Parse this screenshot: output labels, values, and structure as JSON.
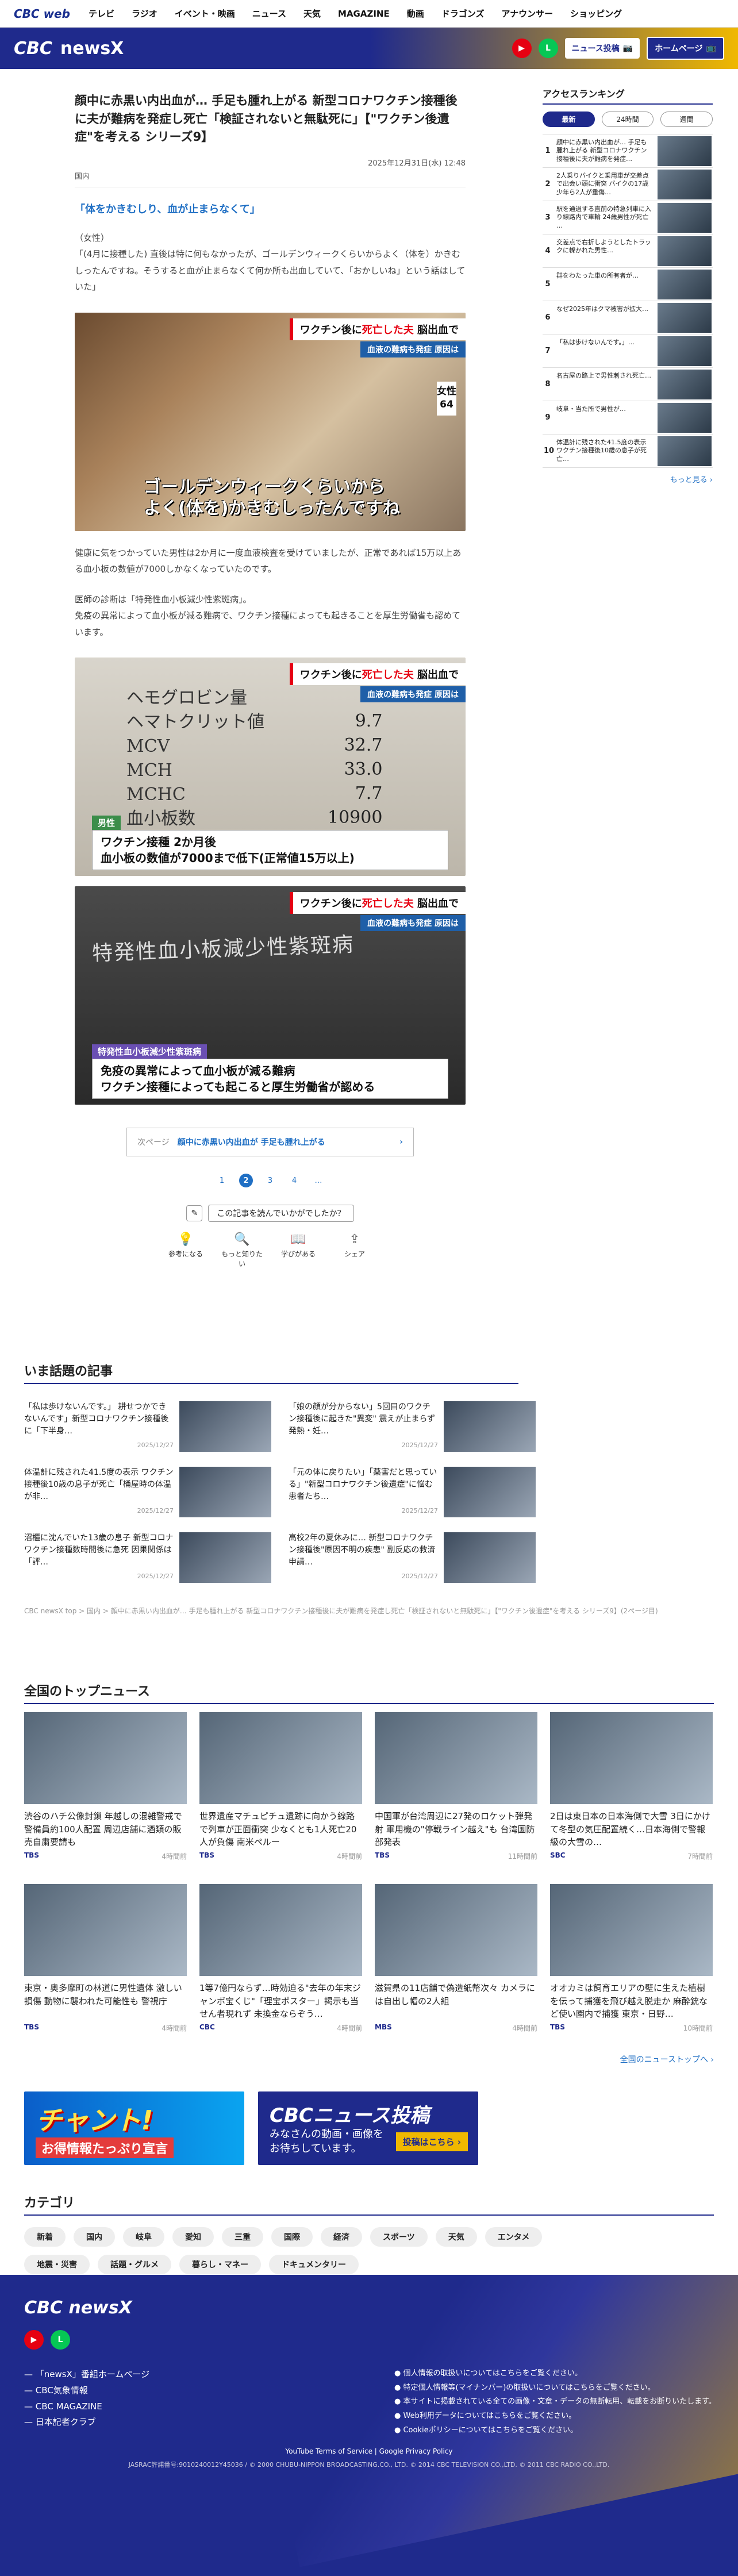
{
  "top_nav": {
    "logo": "CBC web",
    "items": [
      "テレビ",
      "ラジオ",
      "イベント・映画",
      "ニュース",
      "天気",
      "MAGAZINE",
      "動画",
      "ドラゴンズ",
      "アナウンサー",
      "ショッピング"
    ]
  },
  "header": {
    "logo_cbc": "CBC",
    "logo_news": "newsX",
    "btn_post": "ニュース投稿",
    "btn_home": "ホームページ"
  },
  "article": {
    "title": "顔中に赤黒い内出血が… 手足も腫れ上がる 新型コロナワクチン接種後に夫が難病を発症し死亡「検証されないと無駄死に」【\"ワクチン後遺症\"を考える シリーズ9】",
    "date": "2025年12月31日(水) 12:48",
    "category": "国内",
    "subhead": "「体をかきむしり、血が止まらなくて」",
    "para1": "（女性）\n「(4月に接種した) 直後は特に何もなかったが、ゴールデンウィークくらいからよく（体を）かきむしったんですね。そうすると血が止まらなくて何か所も出血していて、「おかしいね」という話はしていた」",
    "para2": "健康に気をつかっていた男性は2か月に一度血液検査を受けていましたが、正常であれば15万以上ある血小板の数値が7000しかなくなっていたのです。",
    "para3": "医師の診断は「特発性血小板減少性紫斑病」。\n免疫の異常によって血小板が減る難病で、ワクチン接種によっても起きることを厚生労働省も認めています。",
    "badge_pre": "ワクチン後に",
    "badge_red": "死亡した夫",
    "badge_post": "脳出血で",
    "badge_sub": "血液の難病も発症 原因は",
    "photo1_caption": "ゴールデンウィークくらいから\nよく(体を)かきむしったんですね",
    "photo1_label": "女性",
    "photo1_age": "64",
    "photo2_items": "ヘモグロビン量\nヘマトクリット値\nMCV\nMCH\nMCHC\n血小板数",
    "photo2_nums": "9.7\n32.7\n33.0\n7.7\n10900",
    "photo2_label": "男性",
    "photo2_caption": "ワクチン接種 2か月後\n血小板の数値が7000まで低下(正常値15万以上)",
    "photo3_doc": "特発性血小板減少性紫斑病",
    "photo3_label": "特発性血小板減少性紫斑病",
    "photo3_caption": "免疫の異常によって血小板が減る難病\nワクチン接種によっても起こると厚生労働省が認める",
    "next_label": "次ページ",
    "next_text": "顔中に赤黒い内出血が 手足も腫れ上がる",
    "pages": [
      "1",
      "2",
      "3",
      "4",
      "…"
    ],
    "feedback_prompt": "この記事を読んでいかがでしたか？",
    "reactions": [
      "参考になる",
      "もっと知りたい",
      "学びがある",
      "シェア"
    ]
  },
  "sidebar": {
    "title": "アクセスランキング",
    "tabs": [
      "最新",
      "24時間",
      "週間"
    ],
    "items": [
      "顔中に赤黒い内出血が… 手足も腫れ上がる 新型コロナワクチン接種後に夫が難病を発症…",
      "2人乗りバイクと乗用車が交差点で出会い頭に衝突 バイクの17歳少年ら2人が重傷…",
      "駅を通過する直前の特急列車に入り線路内で車輪 24歳男性が死亡 …",
      "交差点で右折しようとしたトラックに轢かれた男性…",
      "群をわたった車の所有者が…",
      "なぜ2025年はクマ被害が拡大…",
      "「私は歩けないんです。」…",
      "名古屋の路上で男性刺され死亡…",
      "岐阜・当た所で男性が…",
      "体温計に残された41.5度の表示 ワクチン接種後10歳の息子が死亡…"
    ],
    "more": "もっと見る ›"
  },
  "trending": {
    "title": "いま話題の記事",
    "items": [
      {
        "title": "「私は歩けないんです。」 耕せつかできないんです」新型コロナワクチン接種後に「下半身…",
        "date": "2025/12/27"
      },
      {
        "title": "「娘の顔が分からない」5回目のワクチン接種後に起きた\"異変\" 震えが止まらず発熱・妊…",
        "date": "2025/12/27"
      },
      {
        "title": "体温計に残された41.5度の表示 ワクチン接種後10歳の息子が死亡「桶屋時の体温が非…",
        "date": "2025/12/27"
      },
      {
        "title": "「元の体に戻りたい」「薬害だと思っている」\"新型コロナワクチン後遺症\"に悩む患者たち…",
        "date": "2025/12/27"
      },
      {
        "title": "沼櫃に沈んでいた13歳の息子 新型コロナワクチン接種数時間後に急死 因果関係は「評…",
        "date": "2025/12/27"
      },
      {
        "title": "高校2年の夏休みに… 新型コロナワクチン接種後\"原因不明の疾患\" 副反応の救済申請…",
        "date": "2025/12/27"
      }
    ]
  },
  "breadcrumb": "CBC newsX top > 国内 > 顔中に赤黒い内出血が… 手足も腫れ上がる 新型コロナワクチン接種後に夫が難病を発症し死亡「検証されないと無駄死に」【\"ワクチン後遺症\"を考える シリーズ9】(2ページ目)",
  "top_news": {
    "title": "全国のトップニュース",
    "items": [
      {
        "title": "渋谷のハチ公像封鎖 年越しの混雑警戒で警備員約100人配置 周辺店舗に酒類の販売自粛要請も",
        "src": "TBS",
        "ago": "4時間前"
      },
      {
        "title": "世界遺産マチュピチュ遺跡に向かう線路で列車が正面衝突 少なくとも1人死亡20人が負傷 南米ペルー",
        "src": "TBS",
        "ago": "4時間前"
      },
      {
        "title": "中国軍が台湾周辺に27発のロケット弾発射 軍用機の\"停戦ライン越え\"も 台湾国防部発表",
        "src": "TBS",
        "ago": "11時間前"
      },
      {
        "title": "2日は東日本の日本海側で大雪 3日にかけて冬型の気圧配置続く…日本海側で警報級の大雪の…",
        "src": "SBC",
        "ago": "7時間前"
      },
      {
        "title": "東京・奥多摩町の林道に男性遺体 激しい損傷 動物に襲われた可能性も 警視庁",
        "src": "TBS",
        "ago": "4時間前"
      },
      {
        "title": "1等7億円ならず…時効迫る\"去年の年末ジャンボ宝くじ\"「理宝ポスター」掲示も当せん者現れず 未換金ならぞう…",
        "src": "CBC",
        "ago": "4時間前"
      },
      {
        "title": "滋賀県の11店舗で偽造紙幣次々 カメラには自出し帽の2人組",
        "src": "MBS",
        "ago": "4時間前"
      },
      {
        "title": "オオカミは飼育エリアの壁に生えた植樹を伝って捕獲を飛び越え脱走か 麻酔銃など使い園内で捕獲 東京・日野…",
        "src": "TBS",
        "ago": "10時間前"
      }
    ],
    "more": "全国のニューストップへ ›"
  },
  "banners": {
    "b1_title": "チャント!",
    "b1_sub": "お得情報たっぷり宣言",
    "b2_title": "CBCニュース投稿",
    "b2_sub": "みなさんの動画・画像を\nお待ちしています。",
    "b2_btn": "投稿はこちら ›"
  },
  "categories": {
    "title": "カテゴリ",
    "items": [
      "新着",
      "国内",
      "岐阜",
      "愛知",
      "三重",
      "国際",
      "経済",
      "スポーツ",
      "天気",
      "エンタメ",
      "地震・災害",
      "話題・グルメ",
      "暮らし・マネー",
      "ドキュメンタリー"
    ]
  },
  "footer": {
    "logo": "CBC newsX",
    "links": [
      "「newsX」番組ホームページ",
      "CBC気象情報",
      "CBC MAGAZINE",
      "日本記者クラブ"
    ],
    "links2": [
      "個人情報の取扱いについてはこちらをご覧ください。",
      "特定個人情報等(マイナンバー)の取扱いについてはこちらをご覧ください。",
      "本サイトに掲載されている全ての画像・文章・データの無断転用、転載をお断りいたします。",
      "Web利用データについてはこちらをご覧ください。",
      "Cookieポリシーについてはこちらをご覧ください。"
    ],
    "policy": "YouTube Terms of Service | Google Privacy Policy",
    "copyright": "JASRAC許諾番号:9010240012Y45036 / © 2000 CHUBU-NIPPON BROADCASTING.CO., LTD. © 2014 CBC TELEVISION CO.,LTD. © 2011 CBC RADIO CO.,LTD."
  },
  "colors": {
    "brand": "#1f2a8c",
    "accent": "#f0b800",
    "link": "#1f6fc4",
    "alert": "#e60012"
  }
}
